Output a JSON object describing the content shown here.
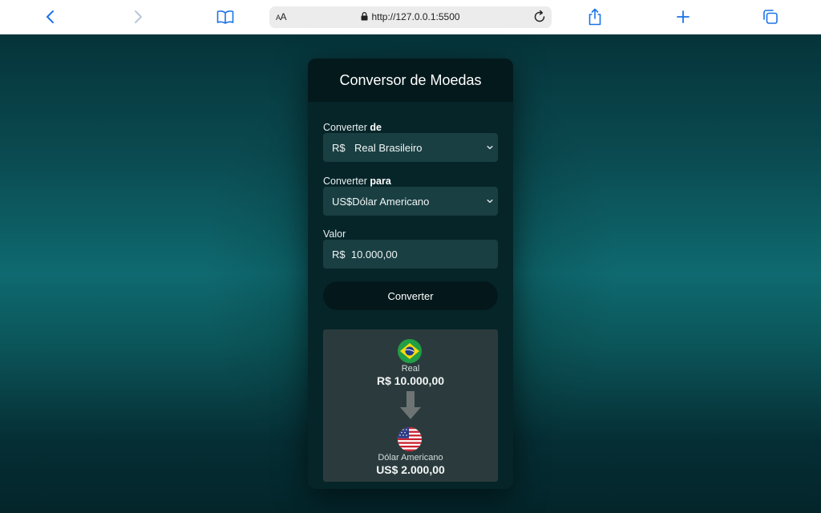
{
  "browser": {
    "url": "http://127.0.0.1:5500",
    "text_size_label": "AA"
  },
  "converter": {
    "title": "Conversor de Moedas",
    "from_label_prefix": "Converter",
    "from_label_bold": "de",
    "from_symbol": "R$",
    "from_name": "Real Brasileiro",
    "to_label_prefix": "Converter",
    "to_label_bold": "para",
    "to_symbol": "US$",
    "to_name": "Dólar Americano",
    "amount_label": "Valor",
    "amount_value": "R$  10.000,00",
    "convert_button": "Converter"
  },
  "result": {
    "from_currency_name": "Real",
    "from_value": "R$ 10.000,00",
    "to_currency_name": "Dólar Americano",
    "to_value": "US$ 2.000,00"
  },
  "colors": {
    "page_bg": "#0e6a70",
    "card_bg": "#062529",
    "header_bg": "#04191c",
    "input_bg": "#1a3f42",
    "button_bg": "#04181b",
    "result_bg": "#2b3b3d",
    "browser_accent": "#1a73e8"
  },
  "icons": {
    "back": "chevron-left-icon",
    "forward": "chevron-right-icon",
    "bookmarks": "book-icon",
    "lock": "lock-icon",
    "reload": "reload-icon",
    "share": "share-icon",
    "new_tab": "plus-icon",
    "tabs": "tabs-icon",
    "from_flag": "brazil-flag-icon",
    "to_flag": "usa-flag-icon",
    "convert_arrow": "arrow-down-icon"
  }
}
